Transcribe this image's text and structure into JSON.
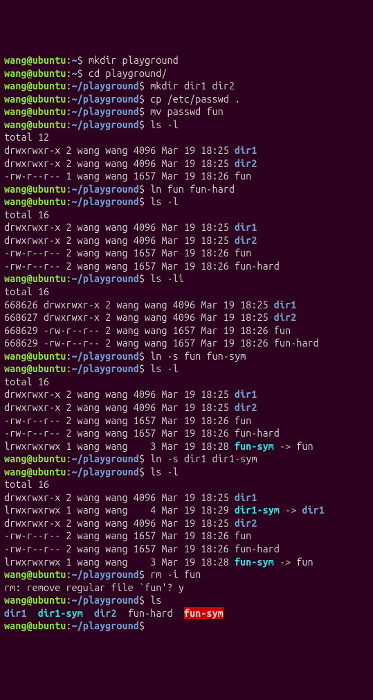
{
  "prompt": {
    "user": "wang",
    "host": "ubuntu",
    "home": "~",
    "pg": "~/playground",
    "sym": "$"
  },
  "cmds": {
    "mkdir_pg": "mkdir playground",
    "cd_pg": "cd playground/",
    "mkdir_dirs": "mkdir dir1 dir2",
    "cp": "cp /etc/passwd .",
    "mv": "mv passwd fun",
    "lsl": "ls -l",
    "ln_hard": "ln fun fun-hard",
    "lsli": "ls -li",
    "ln_sym": "ln -s fun fun-sym",
    "ln_dir_sym": "ln -s dir1 dir1-sym",
    "rm": "rm -i fun",
    "rm_prompt": "rm: remove regular file `fun'? y",
    "ls": "ls"
  },
  "totals": {
    "t12": "total 12",
    "t16": "total 16"
  },
  "lslist1": [
    {
      "perm": "drwxrwxr-x",
      "n": "2",
      "o": "wang",
      "g": "wang",
      "sz": "4096",
      "d": "Mar 19 18:25",
      "name": "dir1",
      "cls": "dir"
    },
    {
      "perm": "drwxrwxr-x",
      "n": "2",
      "o": "wang",
      "g": "wang",
      "sz": "4096",
      "d": "Mar 19 18:25",
      "name": "dir2",
      "cls": "dir"
    },
    {
      "perm": "-rw-r--r--",
      "n": "1",
      "o": "wang",
      "g": "wang",
      "sz": "1657",
      "d": "Mar 19 18:26",
      "name": "fun",
      "cls": ""
    }
  ],
  "lslist2": [
    {
      "perm": "drwxrwxr-x",
      "n": "2",
      "o": "wang",
      "g": "wang",
      "sz": "4096",
      "d": "Mar 19 18:25",
      "name": "dir1",
      "cls": "dir"
    },
    {
      "perm": "drwxrwxr-x",
      "n": "2",
      "o": "wang",
      "g": "wang",
      "sz": "4096",
      "d": "Mar 19 18:25",
      "name": "dir2",
      "cls": "dir"
    },
    {
      "perm": "-rw-r--r--",
      "n": "2",
      "o": "wang",
      "g": "wang",
      "sz": "1657",
      "d": "Mar 19 18:26",
      "name": "fun",
      "cls": ""
    },
    {
      "perm": "-rw-r--r--",
      "n": "2",
      "o": "wang",
      "g": "wang",
      "sz": "1657",
      "d": "Mar 19 18:26",
      "name": "fun-hard",
      "cls": ""
    }
  ],
  "lslisti": [
    {
      "ino": "668626",
      "perm": "drwxrwxr-x",
      "n": "2",
      "o": "wang",
      "g": "wang",
      "sz": "4096",
      "d": "Mar 19 18:25",
      "name": "dir1",
      "cls": "dir"
    },
    {
      "ino": "668627",
      "perm": "drwxrwxr-x",
      "n": "2",
      "o": "wang",
      "g": "wang",
      "sz": "4096",
      "d": "Mar 19 18:25",
      "name": "dir2",
      "cls": "dir"
    },
    {
      "ino": "668629",
      "perm": "-rw-r--r--",
      "n": "2",
      "o": "wang",
      "g": "wang",
      "sz": "1657",
      "d": "Mar 19 18:26",
      "name": "fun",
      "cls": ""
    },
    {
      "ino": "668629",
      "perm": "-rw-r--r--",
      "n": "2",
      "o": "wang",
      "g": "wang",
      "sz": "1657",
      "d": "Mar 19 18:26",
      "name": "fun-hard",
      "cls": ""
    }
  ],
  "lslist3": [
    {
      "perm": "drwxrwxr-x",
      "n": "2",
      "o": "wang",
      "g": "wang",
      "sz": "4096",
      "d": "Mar 19 18:25",
      "name": "dir1",
      "cls": "dir"
    },
    {
      "perm": "drwxrwxr-x",
      "n": "2",
      "o": "wang",
      "g": "wang",
      "sz": "4096",
      "d": "Mar 19 18:25",
      "name": "dir2",
      "cls": "dir"
    },
    {
      "perm": "-rw-r--r--",
      "n": "2",
      "o": "wang",
      "g": "wang",
      "sz": "1657",
      "d": "Mar 19 18:26",
      "name": "fun",
      "cls": ""
    },
    {
      "perm": "-rw-r--r--",
      "n": "2",
      "o": "wang",
      "g": "wang",
      "sz": "1657",
      "d": "Mar 19 18:26",
      "name": "fun-hard",
      "cls": ""
    },
    {
      "perm": "lrwxrwxrwx",
      "n": "1",
      "o": "wang",
      "g": "wang",
      "sz": "   3",
      "d": "Mar 19 18:28",
      "name": "fun-sym",
      "cls": "sym",
      "target": "fun"
    }
  ],
  "lslist4": [
    {
      "perm": "drwxrwxr-x",
      "n": "2",
      "o": "wang",
      "g": "wang",
      "sz": "4096",
      "d": "Mar 19 18:25",
      "name": "dir1",
      "cls": "dir"
    },
    {
      "perm": "lrwxrwxrwx",
      "n": "1",
      "o": "wang",
      "g": "wang",
      "sz": "   4",
      "d": "Mar 19 18:29",
      "name": "dir1-sym",
      "cls": "sym",
      "target": "dir1",
      "tcls": "dir"
    },
    {
      "perm": "drwxrwxr-x",
      "n": "2",
      "o": "wang",
      "g": "wang",
      "sz": "4096",
      "d": "Mar 19 18:25",
      "name": "dir2",
      "cls": "dir"
    },
    {
      "perm": "-rw-r--r--",
      "n": "2",
      "o": "wang",
      "g": "wang",
      "sz": "1657",
      "d": "Mar 19 18:26",
      "name": "fun",
      "cls": ""
    },
    {
      "perm": "-rw-r--r--",
      "n": "2",
      "o": "wang",
      "g": "wang",
      "sz": "1657",
      "d": "Mar 19 18:26",
      "name": "fun-hard",
      "cls": ""
    },
    {
      "perm": "lrwxrwxrwx",
      "n": "1",
      "o": "wang",
      "g": "wang",
      "sz": "   3",
      "d": "Mar 19 18:28",
      "name": "fun-sym",
      "cls": "sym",
      "target": "fun"
    }
  ],
  "ls_short": [
    {
      "name": "dir1",
      "cls": "dir"
    },
    {
      "name": "dir1-sym",
      "cls": "sym"
    },
    {
      "name": "dir2",
      "cls": "dir"
    },
    {
      "name": "fun-hard",
      "cls": ""
    },
    {
      "name": "fun-sym",
      "cls": "broken"
    }
  ],
  "arrow": " -> "
}
